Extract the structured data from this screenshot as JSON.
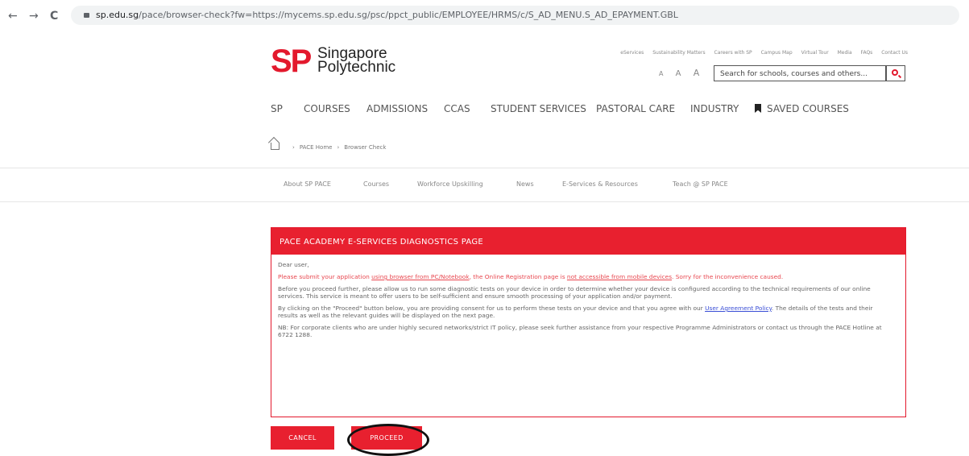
{
  "browser": {
    "back": "←",
    "forward": "→",
    "reload": "C",
    "url_domain": "sp.edu.sg",
    "url_path": "/pace/browser-check?fw=https://mycems.sp.edu.sg/psc/ppct_public/EMPLOYEE/HRMS/c/S_AD_MENU.S_AD_EPAYMENT.GBL"
  },
  "logo": {
    "mark": "SP",
    "line1": "Singapore",
    "line2": "Polytechnic"
  },
  "util_links": [
    "eServices",
    "Sustainability Matters",
    "Careers with SP",
    "Campus Map",
    "Virtual Tour",
    "Media",
    "FAQs",
    "Contact Us"
  ],
  "font_sizes": [
    "A",
    "A",
    "A"
  ],
  "search": {
    "placeholder": "Search for schools, courses and others...",
    "icon": "search-icon"
  },
  "main_nav": [
    "SP",
    "COURSES",
    "ADMISSIONS",
    "CCAS",
    "STUDENT SERVICES",
    "PASTORAL CARE",
    "INDUSTRY",
    "SAVED COURSES"
  ],
  "breadcrumb": {
    "home_icon": "home-icon",
    "items": [
      "PACE Home",
      "Browser Check"
    ],
    "separator": "›"
  },
  "sub_nav": [
    "About SP PACE",
    "Courses",
    "Workforce Upskilling",
    "News",
    "E-Services & Resources",
    "Teach @ SP PACE"
  ],
  "panel": {
    "title": "PACE ACADEMY E-SERVICES DIAGNOSTICS PAGE",
    "greeting": "Dear user,",
    "warn_1": "Please submit your application ",
    "warn_link1": "using browser from PC/Notebook",
    "warn_2": ", the Online Registration page is ",
    "warn_link2": "not accessible from mobile devices",
    "warn_3": ". Sorry for the inconvenience caused.",
    "para2": "Before you proceed further, please allow us to run some diagnostic tests on your device in order to determine whether your device is configured according to the technical requirements of our online services. This service is meant to offer users to be self-sufficient and ensure smooth processing of your application and/or payment.",
    "para3_a": "By clicking on the \"Proceed\" button below, you are providing consent for us to perform these tests on your device and that you agree with our ",
    "para3_link": "User Agreement Policy",
    "para3_b": ". The details of the tests and their results as well as the relevant guides will be displayed on the next page.",
    "para4": "NB: For corporate clients who are under highly secured networks/strict IT policy, please seek further assistance from your respective Programme Administrators or contact us through the PACE Hotline at 6722 1288."
  },
  "buttons": {
    "cancel": "CANCEL",
    "proceed": "PROCEED"
  },
  "colors": {
    "brand_red": "#e3192d",
    "panel_red": "#e8202f",
    "link_blue": "#3a4ed6"
  }
}
